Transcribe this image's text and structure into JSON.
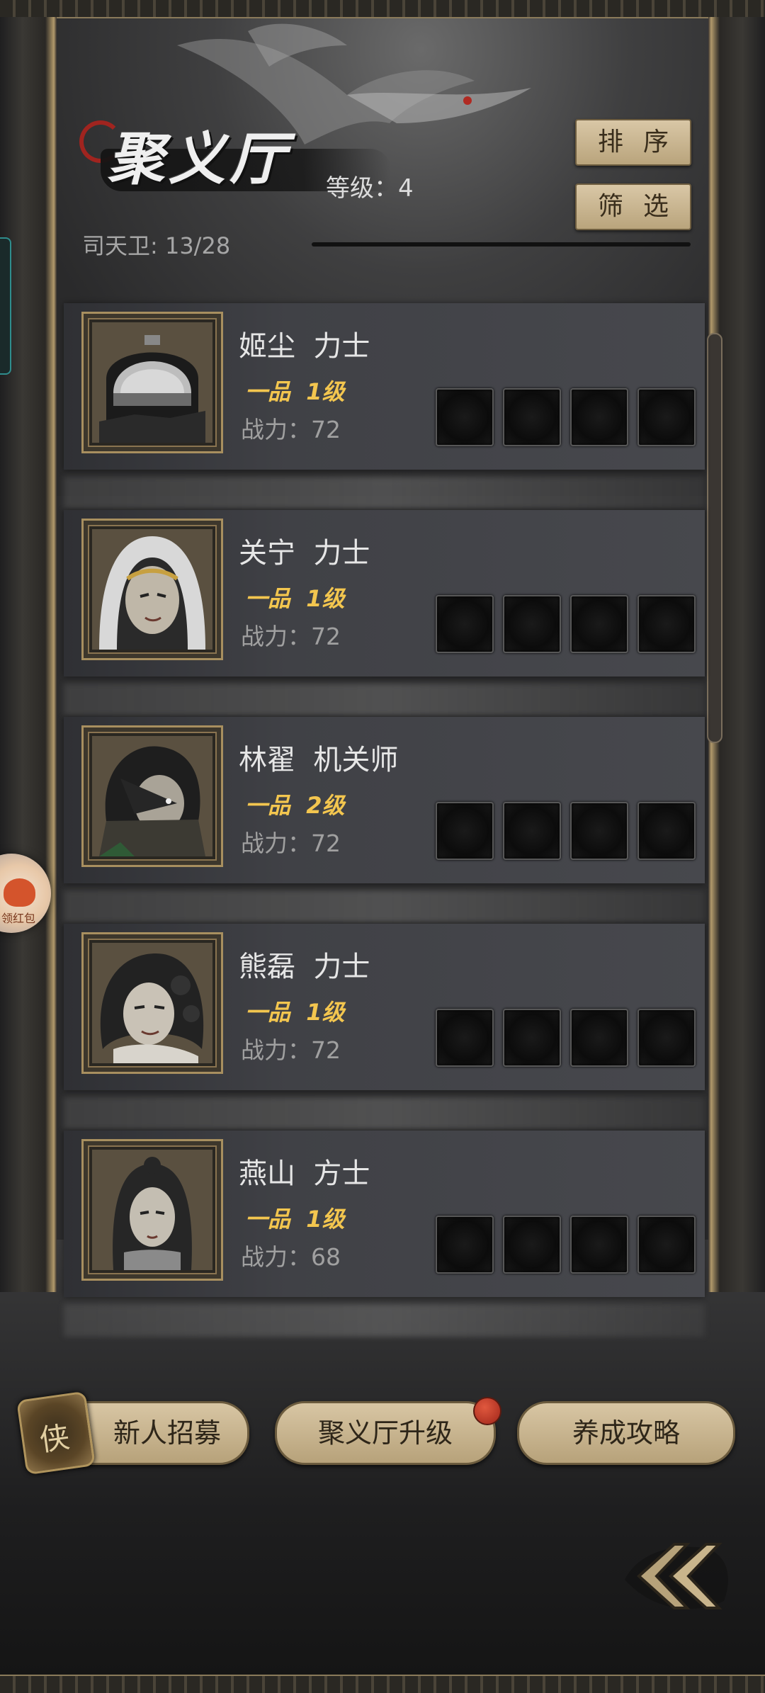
{
  "header": {
    "title": "聚义厅",
    "level_label": "等级：4",
    "guard_count": "司天卫: 13/28",
    "sort_button": "排序",
    "filter_button": "筛选"
  },
  "heroes": [
    {
      "name": "姬尘  力士",
      "rank": "一品  1级",
      "power": "战力：72",
      "portrait": "helmet-warrior-portrait"
    },
    {
      "name": "关宁  力士",
      "rank": "一品  1级",
      "power": "战力：72",
      "portrait": "hooded-woman-portrait"
    },
    {
      "name": "林翟  机关师",
      "rank": "一品  2级",
      "power": "战力：72",
      "portrait": "masked-mechanist-portrait"
    },
    {
      "name": "熊磊  力士",
      "rank": "一品  1级",
      "power": "战力：72",
      "portrait": "curly-hair-woman-portrait"
    },
    {
      "name": "燕山  方士",
      "rank": "一品  1级",
      "power": "战力：68",
      "portrait": "long-hair-sorcerer-portrait"
    }
  ],
  "bottom_bar": {
    "recruit": "新人招募",
    "recruit_icon_char": "侠",
    "upgrade": "聚义厅升级",
    "guide": "养成攻略"
  },
  "side_float_text": "领红包",
  "colors": {
    "rank_gold": "#f3c64f",
    "button_tan": "#d8c6a4",
    "notify_red": "#c0392b"
  }
}
